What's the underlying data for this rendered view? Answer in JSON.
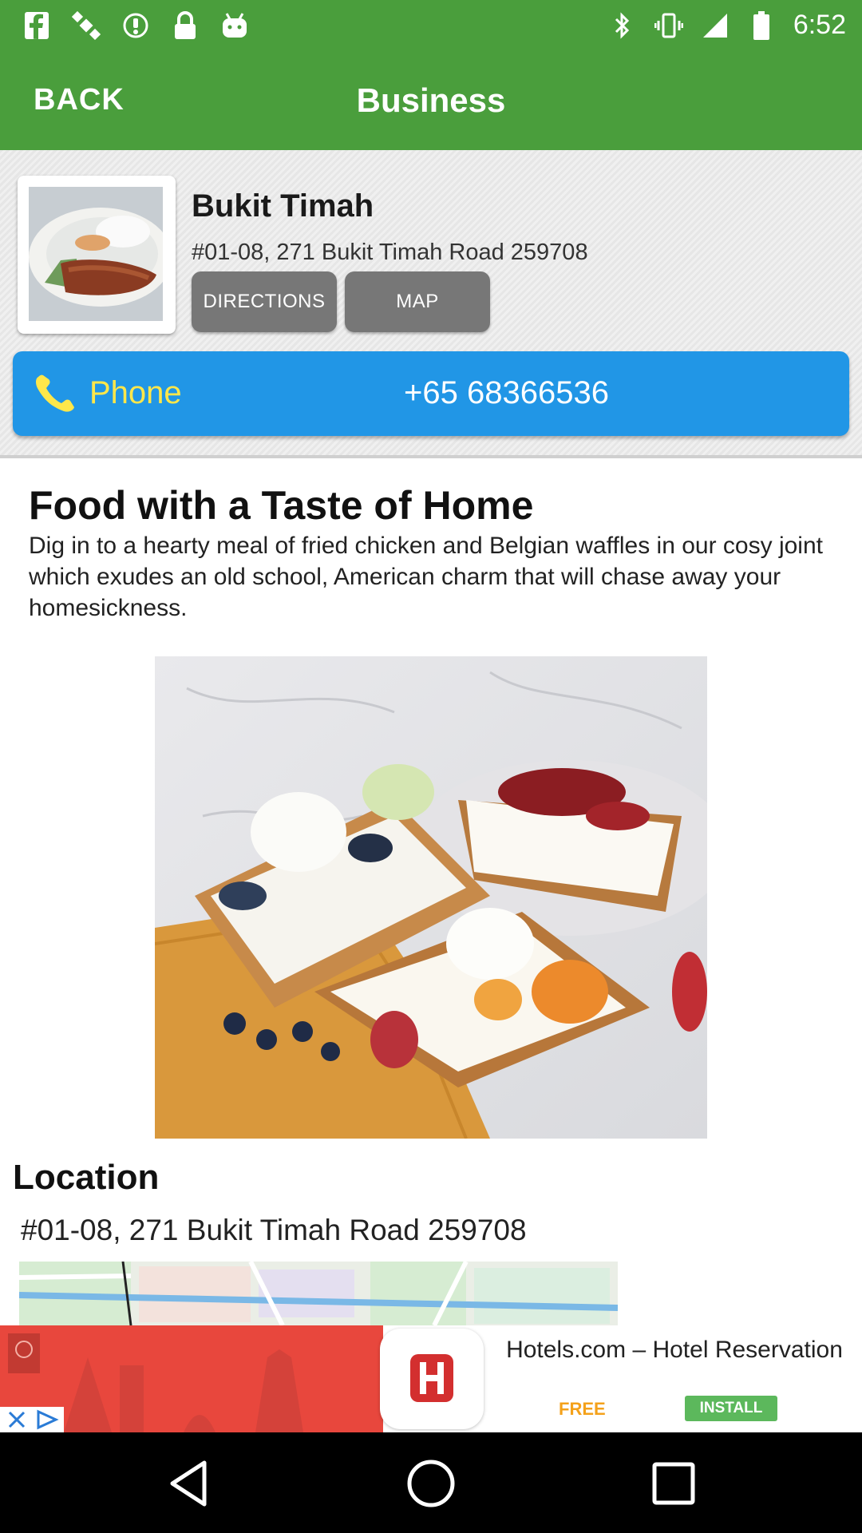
{
  "status_bar": {
    "time": "6:52",
    "left_icons": [
      "facebook-icon",
      "satellite-icon",
      "info-icon",
      "lock-icon",
      "android-icon"
    ],
    "right_icons": [
      "bluetooth-icon",
      "vibrate-icon",
      "signal-icon",
      "battery-icon"
    ]
  },
  "app_bar": {
    "back_label": "BACK",
    "title": "Business"
  },
  "business": {
    "name": "Bukit Timah",
    "address": "#01-08, 271 Bukit Timah Road 259708",
    "directions_label": "DIRECTIONS",
    "map_label": "MAP",
    "phone_label": "Phone",
    "phone_number": "+65 68366536"
  },
  "content": {
    "title": "Food with a Taste of Home",
    "description": "Dig in to a hearty meal of fried chicken and Belgian waffles in our cosy joint which exudes an old school, American charm that will chase away your homesickness.",
    "location_title": "Location",
    "location_address": "#01-08, 271 Bukit Timah Road 259708"
  },
  "ad": {
    "title": "Hotels.com – Hotel Reservation",
    "price_label": "FREE",
    "install_label": "INSTALL"
  },
  "colors": {
    "primary": "#4a9e3c",
    "phone_bar": "#2196e6",
    "phone_label": "#ffe74a",
    "button_gray": "#777777"
  }
}
